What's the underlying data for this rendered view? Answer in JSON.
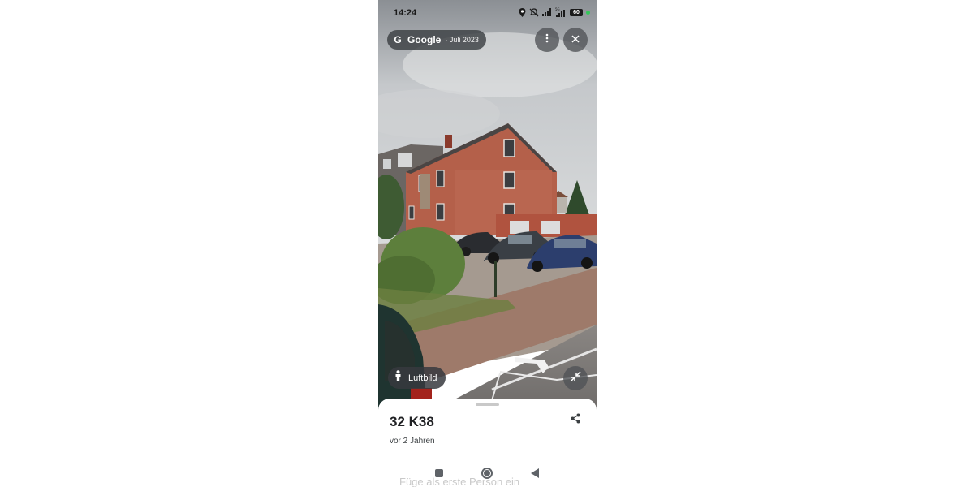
{
  "status_bar": {
    "time": "14:24",
    "battery": "60",
    "icons": [
      "location-icon",
      "mute-icon",
      "signal-icon",
      "signal-5g-icon",
      "battery-icon"
    ]
  },
  "street_view": {
    "brand": "Google",
    "date": "· Juli 2023",
    "more_icon": "more-vert-icon",
    "close_icon": "close-icon",
    "layer_label": "Luftbild",
    "layer_icon": "pegman-icon",
    "collapse_icon": "collapse-icon"
  },
  "sheet": {
    "title": "32 K38",
    "subtitle": "vor 2 Jahren",
    "share_icon": "share-icon",
    "ghost_text": "Füge als erste Person ein"
  },
  "nav": {
    "icons": [
      "recents-icon",
      "home-icon",
      "back-icon"
    ]
  },
  "colors": {
    "chip_bg": "#3c4043",
    "sheet_bg": "#ffffff",
    "title": "#202124"
  }
}
